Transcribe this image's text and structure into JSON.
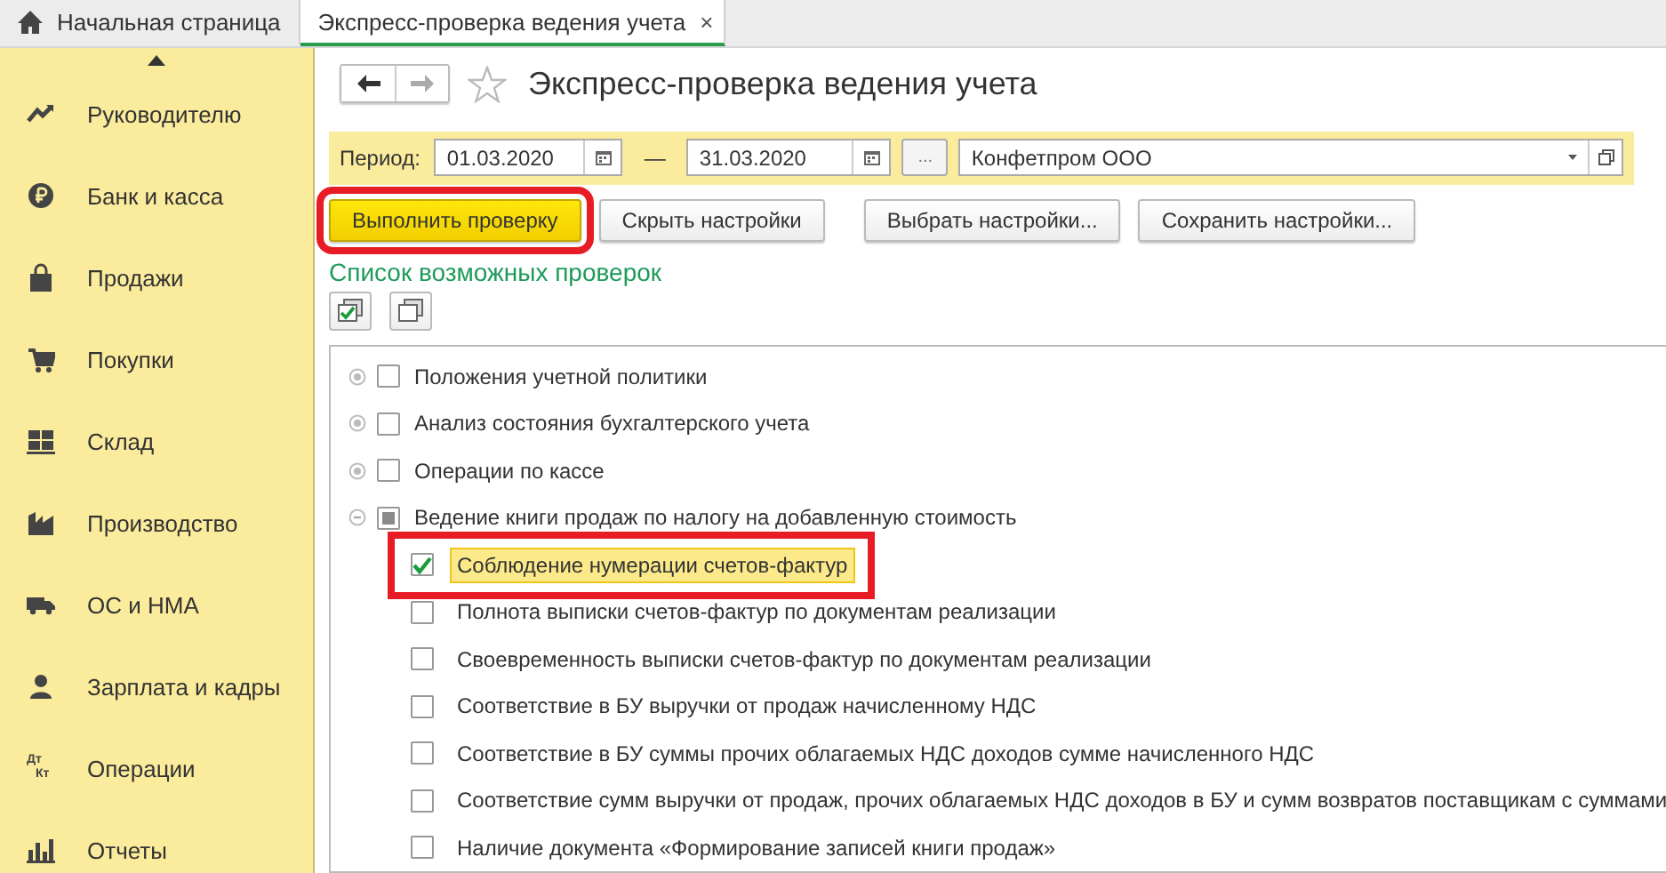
{
  "tabs": [
    {
      "label": "Начальная страница",
      "kind": "home",
      "selected": false
    },
    {
      "label": "Экспресс-проверка ведения учета",
      "kind": "doc",
      "selected": true,
      "close": "×"
    }
  ],
  "sidebar": {
    "items": [
      {
        "label": "Руководителю"
      },
      {
        "label": "Банк и касса"
      },
      {
        "label": "Продажи"
      },
      {
        "label": "Покупки"
      },
      {
        "label": "Склад"
      },
      {
        "label": "Производство"
      },
      {
        "label": "ОС и НМА"
      },
      {
        "label": "Зарплата и кадры"
      },
      {
        "label": "Операции",
        "icon_text": [
          "Дт",
          "Кт"
        ]
      },
      {
        "label": "Отчеты"
      }
    ]
  },
  "form": {
    "title": "Экспресс-проверка ведения учета",
    "period": {
      "label": "Период:",
      "from": "01.03.2020",
      "dash": "—",
      "to": "31.03.2020",
      "more": "...",
      "organization": "Конфетпром ООО"
    },
    "buttons": [
      {
        "label": "Выполнить проверку",
        "kind": "primary",
        "annotated": true
      },
      {
        "label": "Скрыть настройки",
        "kind": "normal",
        "annotated": false
      },
      {
        "label": "Выбрать настройки...",
        "kind": "normal",
        "annotated": false
      },
      {
        "label": "Сохранить настройки...",
        "kind": "normal",
        "annotated": false
      }
    ],
    "list_title": "Список возможных проверок",
    "checks": [
      {
        "label": "Положения учетной политики",
        "checked": false,
        "partial": false,
        "expanded": false
      },
      {
        "label": "Анализ состояния бухгалтерского учета",
        "checked": false,
        "partial": false,
        "expanded": false
      },
      {
        "label": "Операции по кассе",
        "checked": false,
        "partial": false,
        "expanded": false
      },
      {
        "label": "Ведение книги продаж по налогу на добавленную стоимость",
        "checked": false,
        "partial": true,
        "expanded": true,
        "children": [
          {
            "label": "Соблюдение нумерации счетов-фактур",
            "checked": true,
            "selected": true,
            "annotated": true
          },
          {
            "label": "Полнота выписки счетов-фактур по документам реализации",
            "checked": false,
            "selected": false,
            "annotated": false
          },
          {
            "label": "Своевременность выписки счетов-фактур по документам реализации",
            "checked": false,
            "selected": false,
            "annotated": false
          },
          {
            "label": "Соответствие в БУ выручки от продаж начисленному НДС",
            "checked": false,
            "selected": false,
            "annotated": false
          },
          {
            "label": "Соответствие в БУ суммы прочих облагаемых НДС доходов сумме начисленного НДС",
            "checked": false,
            "selected": false,
            "annotated": false
          },
          {
            "label": "Соответствие сумм выручки от продаж, прочих облагаемых НДС доходов в БУ и сумм возвратов поставщикам с суммами",
            "checked": false,
            "selected": false,
            "annotated": false
          },
          {
            "label": "Наличие документа «Формирование записей книги продаж»",
            "checked": false,
            "selected": false,
            "annotated": false
          }
        ]
      }
    ]
  }
}
